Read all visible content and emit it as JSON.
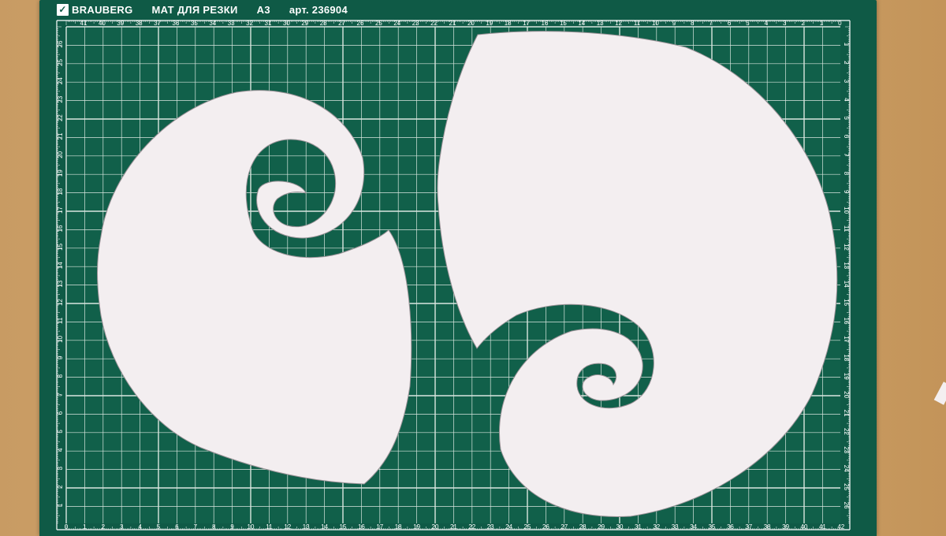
{
  "mat": {
    "brand": "BRAUBERG",
    "product": "МАТ ДЛЯ РЕЗКИ",
    "size": "A3",
    "article": "арт. 236904",
    "top_scale": [
      "41",
      "40",
      "39",
      "38",
      "37",
      "36",
      "35",
      "34",
      "33",
      "32",
      "31",
      "30",
      "29",
      "28",
      "27",
      "26",
      "25",
      "24",
      "23",
      "22",
      "21",
      "20",
      "19",
      "18",
      "17",
      "16",
      "15",
      "14",
      "13",
      "12",
      "11",
      "10",
      "9",
      "8",
      "7",
      "6",
      "5",
      "4",
      "3",
      "2",
      "1",
      "0"
    ],
    "bottom_scale": [
      "0",
      "1",
      "2",
      "3",
      "4",
      "5",
      "6",
      "7",
      "8",
      "9",
      "10",
      "11",
      "12",
      "13",
      "14",
      "15",
      "16",
      "17",
      "18",
      "19",
      "20",
      "21",
      "22",
      "23",
      "24",
      "25",
      "26",
      "27",
      "28",
      "29",
      "30",
      "31",
      "32",
      "33",
      "34",
      "35",
      "36",
      "37",
      "38",
      "39",
      "40",
      "41",
      "42"
    ],
    "left_scale": [
      "26",
      "25",
      "24",
      "23",
      "22",
      "21",
      "20",
      "19",
      "18",
      "17",
      "16",
      "15",
      "14",
      "13",
      "12",
      "11",
      "10",
      "9",
      "8",
      "7",
      "6",
      "5",
      "4",
      "3",
      "2",
      "1"
    ],
    "right_scale": [
      "1",
      "2",
      "3",
      "4",
      "5",
      "6",
      "7",
      "8",
      "9",
      "10",
      "11",
      "12",
      "13",
      "14",
      "15",
      "16",
      "17",
      "18",
      "19",
      "20",
      "21",
      "22",
      "23",
      "24",
      "25",
      "26"
    ]
  },
  "colors": {
    "mat_green": "#0f5a46",
    "grid_line": "#d9e6df",
    "paper": "#f3eef0",
    "table_wood": "#cfa36c"
  }
}
